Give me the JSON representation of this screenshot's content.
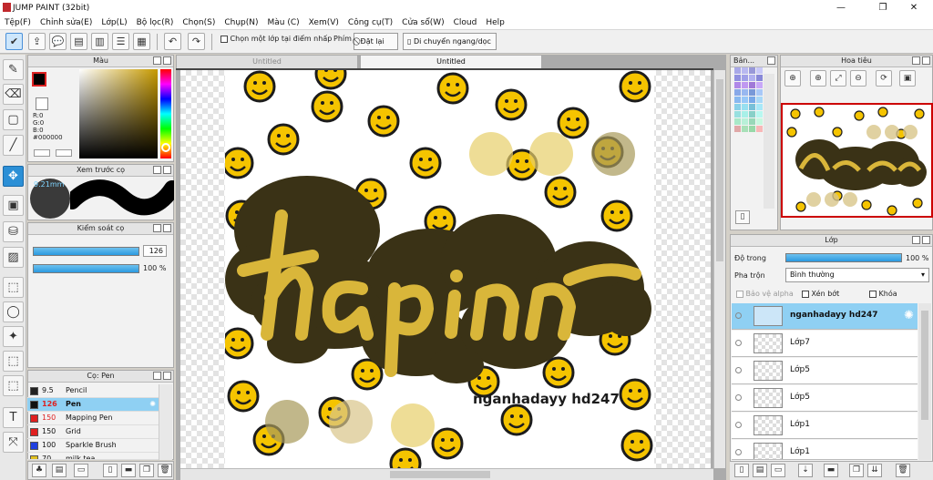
{
  "window": {
    "title": "JUMP PAINT (32bit)",
    "minimize": "—",
    "maximize": "❐",
    "close": "✕"
  },
  "menu": [
    "Tệp(F)",
    "Chỉnh sửa(E)",
    "Lớp(L)",
    "Bộ lọc(R)",
    "Chọn(S)",
    "Chụp(N)",
    "Màu (C)",
    "Xem(V)",
    "Công cụ(T)",
    "Cửa sổ(W)",
    "Cloud",
    "Help"
  ],
  "toolbar": {
    "select_layer_label": "Chọn một lớp tại điểm nhấp",
    "keys_label": "Phím",
    "reset_label": "Đặt lại",
    "move_label": "Di chuyển ngang/dọc"
  },
  "tabs": [
    "Untitled",
    "Untitled"
  ],
  "color_panel": {
    "title": "Màu",
    "r": "R:0",
    "g": "G:0",
    "b": "B:0",
    "hex": "#000000"
  },
  "brush_preview": {
    "title": "Xem trước cọ",
    "size": "9.21mm"
  },
  "brush_control": {
    "title": "Kiểm soát cọ",
    "size_value": "126",
    "opacity_value": "100 %"
  },
  "brush_list": {
    "title": "Cọ: Pen",
    "items": [
      {
        "size": "9.5",
        "name": "Pencil",
        "color": "#222222"
      },
      {
        "size": "126",
        "name": "Pen",
        "color": "#111111",
        "selected": true
      },
      {
        "size": "150",
        "name": "Mapping Pen",
        "color": "#e02020"
      },
      {
        "size": "150",
        "name": "Grid",
        "color": "#e02020"
      },
      {
        "size": "100",
        "name": "Sparkle Brush",
        "color": "#2040e0"
      },
      {
        "size": "70",
        "name": "milk tea",
        "color": "#e0c020"
      }
    ]
  },
  "panels": {
    "materials_title": "Bản...",
    "navigator_title": "Hoa tiêu",
    "layer_title": "Lớp"
  },
  "layer_panel": {
    "opacity_label": "Độ trong",
    "opacity_value": "100 %",
    "blend_label": "Pha trộn",
    "blend_value": "Bình thường",
    "protect_alpha_label": "Bảo vệ alpha",
    "clip_label": "Xén bớt",
    "lock_label": "Khóa"
  },
  "layers": [
    {
      "name": "nganhadayy hd247",
      "selected": true
    },
    {
      "name": "Lớp7"
    },
    {
      "name": "Lớp5"
    },
    {
      "name": "Lớp5"
    },
    {
      "name": "Lớp1"
    },
    {
      "name": "Lớp1"
    }
  ],
  "artwork": {
    "title_text": "hapinn",
    "signature": "nganhadayy hd247"
  },
  "colors": {
    "accent": "#2b8fd6",
    "selection": "#8fd0f3",
    "smiley": "#f5c400",
    "blob": "#3a3216",
    "lettering": "#d9b63a"
  }
}
